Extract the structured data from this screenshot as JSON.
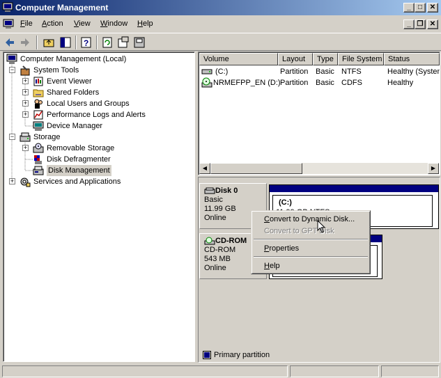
{
  "window": {
    "title": "Computer Management",
    "minimize": "_",
    "maximize": "□",
    "close": "✕"
  },
  "menu": {
    "items": [
      {
        "label": "File",
        "mnemonic": "F",
        "rest": "ile"
      },
      {
        "label": "Action",
        "mnemonic": "A",
        "rest": "ction"
      },
      {
        "label": "View",
        "mnemonic": "V",
        "rest": "iew"
      },
      {
        "label": "Window",
        "mnemonic": "W",
        "rest": "indow"
      },
      {
        "label": "Help",
        "mnemonic": "H",
        "rest": "elp"
      }
    ]
  },
  "toolbar": {
    "buttons": [
      "back-icon",
      "forward-icon",
      "up-folder-icon",
      "show-hide-tree-icon",
      "help-icon",
      "refresh-icon",
      "properties-icon",
      "disk-icon"
    ]
  },
  "tree": {
    "items": [
      {
        "label": "Computer Management (Local)",
        "icon": "computer-icon",
        "expander": "−"
      },
      {
        "label": "System Tools",
        "icon": "tools-icon",
        "expander": "−"
      },
      {
        "label": "Event Viewer",
        "icon": "event-viewer-icon",
        "expander": "+"
      },
      {
        "label": "Shared Folders",
        "icon": "folder-icon",
        "expander": "+"
      },
      {
        "label": "Local Users and Groups",
        "icon": "users-icon",
        "expander": "+"
      },
      {
        "label": "Performance Logs and Alerts",
        "icon": "performance-icon",
        "expander": "+"
      },
      {
        "label": "Device Manager",
        "icon": "device-manager-icon",
        "expander": ""
      },
      {
        "label": "Storage",
        "icon": "storage-icon",
        "expander": "−"
      },
      {
        "label": "Removable Storage",
        "icon": "removable-storage-icon",
        "expander": "+"
      },
      {
        "label": "Disk Defragmenter",
        "icon": "defrag-icon",
        "expander": ""
      },
      {
        "label": "Disk Management",
        "icon": "disk-management-icon",
        "expander": ""
      },
      {
        "label": "Services and Applications",
        "icon": "services-icon",
        "expander": "+"
      }
    ]
  },
  "volumes": {
    "columns": [
      "Volume",
      "Layout",
      "Type",
      "File System",
      "Status"
    ],
    "rows": [
      {
        "volume": "(C:)",
        "layout": "Partition",
        "type": "Basic",
        "fs": "NTFS",
        "status": "Healthy (System"
      },
      {
        "volume": "NRMEFPP_EN (D:)",
        "layout": "Partition",
        "type": "Basic",
        "fs": "CDFS",
        "status": "Healthy"
      }
    ]
  },
  "disks": [
    {
      "name": "Disk 0",
      "kind": "Basic",
      "size": "11.99 GB",
      "state": "Online",
      "partition_label": "(C:)",
      "partition_detail": "11.99 GB NTFS"
    },
    {
      "name": "CD-ROM",
      "kind": "CD-ROM",
      "size": "543 MB",
      "state": "Online"
    }
  ],
  "context_menu": {
    "items": [
      {
        "label": "Convert to Dynamic Disk...",
        "mnemonic": "C",
        "rest": "onvert to Dynamic Disk...",
        "enabled": true
      },
      {
        "label": "Convert to GPT Disk",
        "mnemonic": "",
        "rest": "Convert to GPT Disk",
        "enabled": false
      },
      {
        "label": "Properties",
        "mnemonic": "P",
        "rest": "roperties",
        "enabled": true
      },
      {
        "label": "Help",
        "mnemonic": "H",
        "rest": "elp",
        "enabled": true
      }
    ]
  },
  "legend": {
    "label": "Primary partition",
    "color": "#000080"
  },
  "colors": {
    "title_start": "#0a246a",
    "title_end": "#a6caf0",
    "partition": "#000080",
    "face": "#d4d0c8"
  }
}
